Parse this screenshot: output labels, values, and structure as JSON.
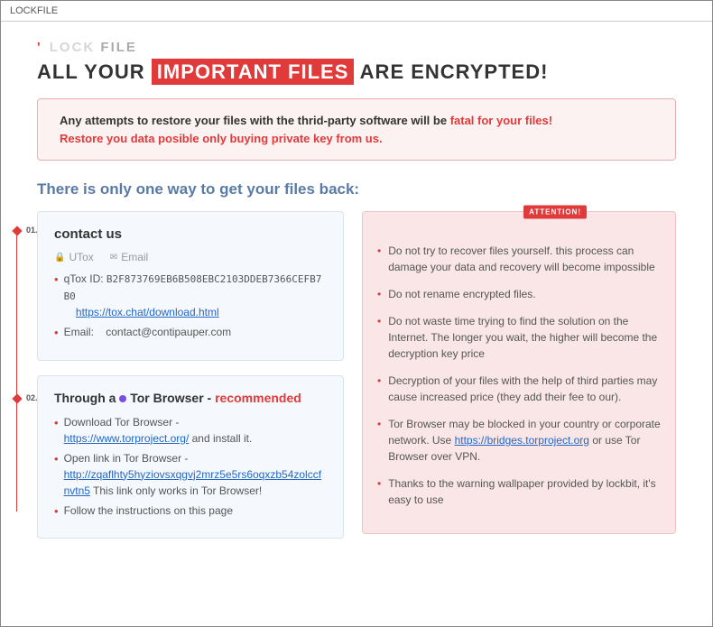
{
  "window": {
    "title": "LOCKFILE"
  },
  "logo": {
    "word1": "LOCK",
    "word2": "FILE"
  },
  "headline": {
    "pre": "ALL YOUR",
    "badge": "IMPORTANT FILES",
    "post": "ARE ENCRYPTED!"
  },
  "alert": {
    "line1_pre": "Any attempts to restore your files with the thrid-party software will be ",
    "line1_fatal": "fatal for your files!",
    "line2": "Restore you data posible only buying private key from us."
  },
  "subhead": "There is only one way to get your files back:",
  "steps": {
    "s1": "01.",
    "s2": "02."
  },
  "contact": {
    "heading": "contact us",
    "tab_utox": "UTox",
    "tab_email": "Email",
    "qtox_label": "qTox ID:",
    "qtox_id": "B2F873769EB6B508EBC2103DDEB7366CEFB7B0",
    "tox_link": "https://tox.chat/download.html",
    "email_label": "Email:",
    "email_value": "contact@contipauper.com"
  },
  "tor": {
    "heading_pre": "Through a ",
    "heading_mid": " Tor Browser - ",
    "heading_rec": "recommended",
    "step1_pre": "Download Tor Browser - ",
    "step1_link": "https://www.torproject.org/",
    "step1_post": " and install it.",
    "step2_pre": "Open link in Tor Browser - ",
    "step2_link": "http://zqaflhty5hyziovsxqgvj2mrz5e5rs6oqxzb54zolccfnvtn5",
    "step2_post": " This link only works in Tor Browser!",
    "step3": "Follow the instructions on this page"
  },
  "warning": {
    "badge": "ATTENTION!",
    "items": [
      "Do not try to recover files yourself. this process can damage your data and recovery will become impossible",
      "Do not rename encrypted files.",
      "Do not waste time trying to find the solution on the Internet. The longer you wait, the higher will become the decryption key price",
      "Decryption of your files with the help of third parties may cause increased price (they add their fee to our).",
      "",
      "Thanks to the warning wallpaper provided by lockbit, it's easy to use"
    ],
    "item5_pre": "Tor Browser may be blocked in your country or corporate network. Use ",
    "item5_link": "https://bridges.torproject.org",
    "item5_post": " or use Tor Browser over VPN."
  }
}
